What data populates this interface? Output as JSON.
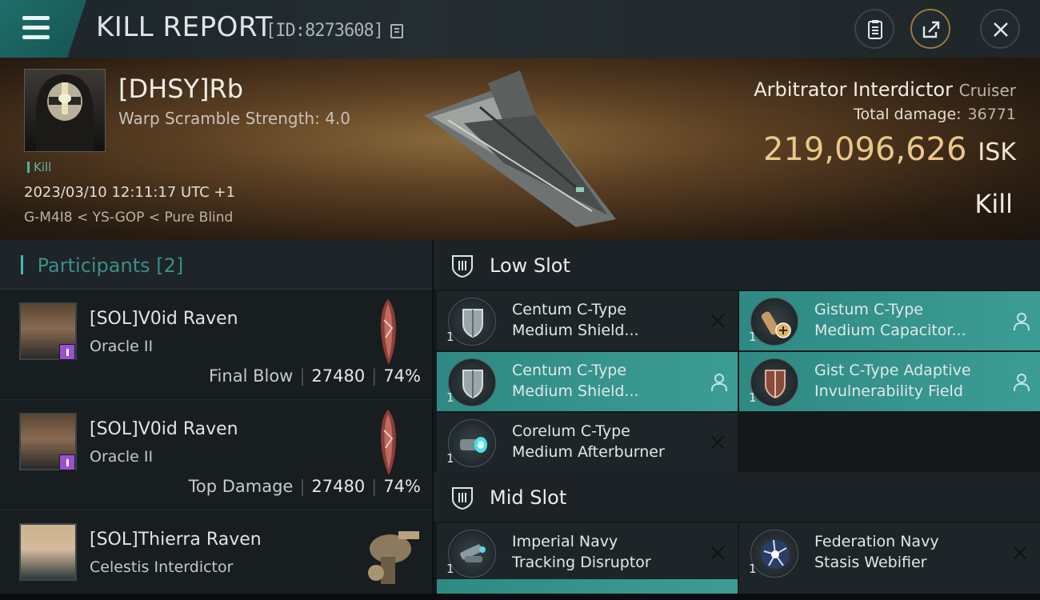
{
  "header": {
    "title": "KILL REPORT",
    "report_id": "[ID:8273608]"
  },
  "victim": {
    "pilot": "[DHSY]Rb",
    "warp": "Warp Scramble Strength: 4.0",
    "tag": "Kill",
    "datetime": "2023/03/10 12:11:17 UTC +1",
    "location": "G-M4I8 < YS-GOP < Pure Blind",
    "ship_name": "Arbitrator Interdictor",
    "ship_class": "Cruiser",
    "damage_label": "Total damage:",
    "damage_value": "36771",
    "isk_value": "219,096,626",
    "isk_unit": "ISK",
    "result": "Kill"
  },
  "participants": {
    "label": "Participants",
    "count": "[2]",
    "rows": [
      {
        "name": "[SOL]V0id Raven",
        "ship": "Oracle II",
        "stat_label": "Final Blow",
        "damage": "27480",
        "percent": "74%"
      },
      {
        "name": "[SOL]V0id Raven",
        "ship": "Oracle II",
        "stat_label": "Top Damage",
        "damage": "27480",
        "percent": "74%"
      },
      {
        "name": "[SOL]Thierra Raven",
        "ship": "Celestis Interdictor"
      }
    ]
  },
  "slots": {
    "low": {
      "label": "Low Slot",
      "items": [
        {
          "qty": "1",
          "line1": "Centum C-Type",
          "line2": "Medium Shield..."
        },
        {
          "qty": "1",
          "line1": "Gistum C-Type",
          "line2": "Medium Capacitor..."
        },
        {
          "qty": "1",
          "line1": "Centum C-Type",
          "line2": "Medium Shield..."
        },
        {
          "qty": "1",
          "line1": "Gist C-Type Adaptive",
          "line2": "Invulnerability Field"
        },
        {
          "qty": "1",
          "line1": "Corelum C-Type",
          "line2": "Medium Afterburner"
        }
      ]
    },
    "mid": {
      "label": "Mid Slot",
      "items": [
        {
          "qty": "1",
          "line1": "Imperial Navy",
          "line2": "Tracking Disruptor"
        },
        {
          "qty": "1",
          "line1": "Federation Navy",
          "line2": "Stasis Webifier"
        }
      ]
    }
  },
  "colors": {
    "accent_teal": "#3c9d95",
    "isk_gold": "#e9c68a"
  }
}
